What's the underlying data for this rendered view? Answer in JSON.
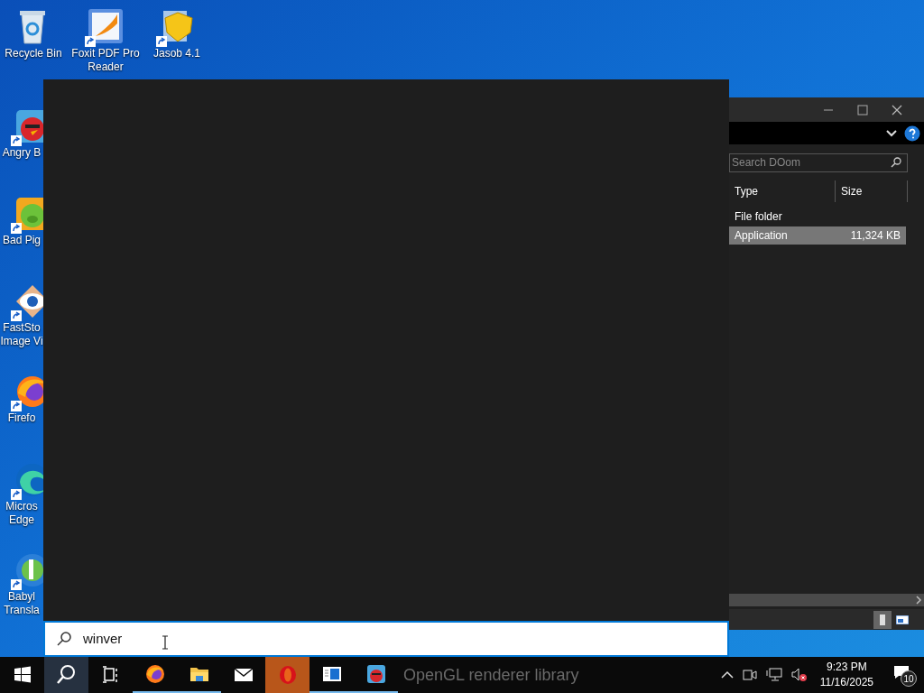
{
  "desktop": {
    "icons": [
      {
        "kind": "recycle",
        "lines": [
          "Recycle Bin"
        ],
        "shortcut": false
      },
      {
        "kind": "pdf",
        "lines": [
          "Foxit PDF Pro",
          "Reader"
        ],
        "shortcut": true
      },
      {
        "kind": "shield",
        "lines": [
          "Jasob 4.1"
        ],
        "shortcut": true
      },
      {
        "kind": "bird",
        "lines": [
          "Angry B"
        ],
        "shortcut": true
      },
      {
        "kind": "pig",
        "lines": [
          "Bad Pig"
        ],
        "shortcut": true
      },
      {
        "kind": "eye",
        "lines": [
          "FastSto",
          "Image Vi"
        ],
        "shortcut": true
      },
      {
        "kind": "fox",
        "lines": [
          "Firefo"
        ],
        "shortcut": true
      },
      {
        "kind": "wave",
        "lines": [
          "Micros",
          "Edge"
        ],
        "shortcut": true
      },
      {
        "kind": "letter",
        "lines": [
          "Babyl",
          "Transla"
        ],
        "shortcut": true
      }
    ]
  },
  "explorer": {
    "search": {
      "placeholder": "Search DOom"
    },
    "columns": [
      "Type",
      "Size"
    ],
    "rows": [
      {
        "type": "File folder",
        "size": "",
        "selected": false
      },
      {
        "type": "Application",
        "size": "11,324 KB",
        "selected": true
      }
    ],
    "view_buttons": [
      {
        "kind": "details",
        "selected": true
      },
      {
        "kind": "tiles",
        "selected": false
      }
    ]
  },
  "search": {
    "value": "winver"
  },
  "taskbar": {
    "buttons": [
      {
        "kind": "start",
        "running": false,
        "active": false
      },
      {
        "kind": "search",
        "running": false,
        "active": true
      },
      {
        "kind": "taskview",
        "running": false,
        "active": false
      },
      {
        "kind": "fox",
        "running": true,
        "active": false
      },
      {
        "kind": "folder",
        "running": true,
        "active": false
      },
      {
        "kind": "mail",
        "running": false,
        "active": false
      },
      {
        "kind": "opera",
        "running": false,
        "active": true
      },
      {
        "kind": "window",
        "running": true,
        "active": false
      },
      {
        "kind": "bird",
        "running": true,
        "active": false
      }
    ],
    "ghost_text": "OpenGL renderer library",
    "clock": {
      "time": "9:23 PM",
      "date": "11/16/2025"
    },
    "notifications": "10"
  }
}
